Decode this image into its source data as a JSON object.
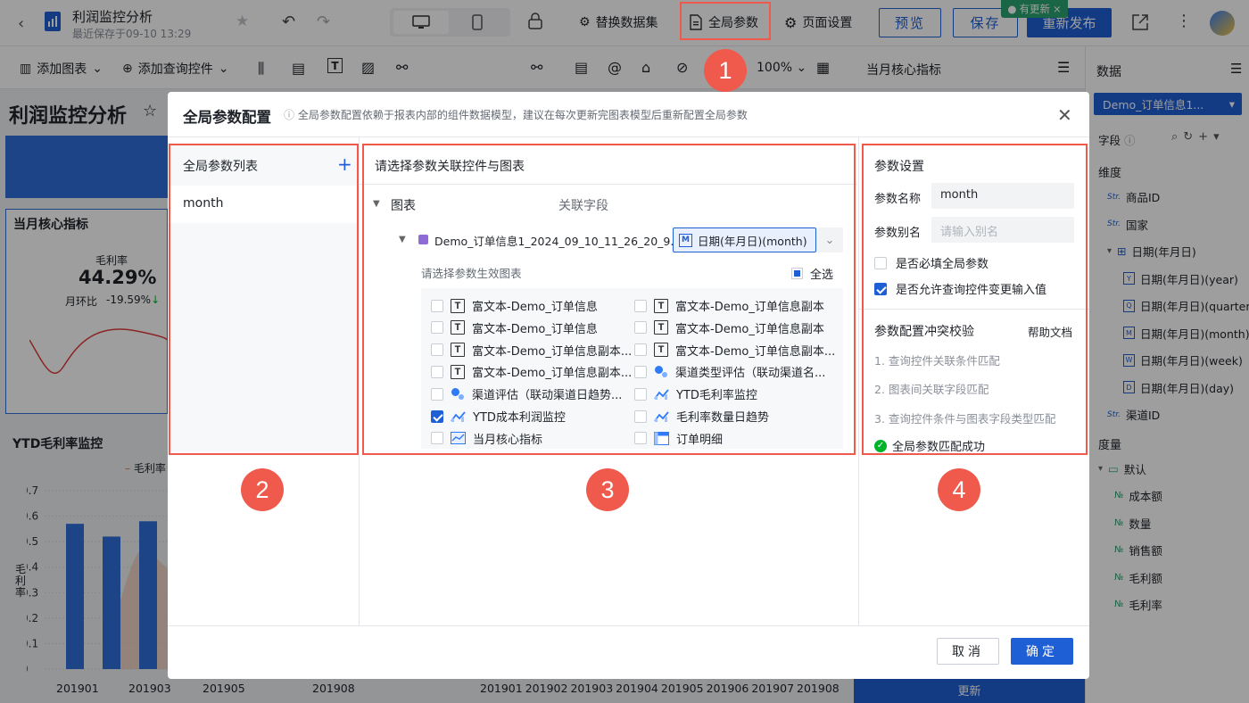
{
  "topbar": {
    "title": "利润监控分析",
    "subtitle": "最近保存于09-10 13:29",
    "switch_dataset": "替换数据集",
    "global_params": "全局参数",
    "page_settings": "页面设置",
    "preview": "预览",
    "save": "保存",
    "republish": "重新发布",
    "update_badge": "有更新"
  },
  "toolbar": {
    "add_chart": "添加图表",
    "add_query": "添加查询控件",
    "zoom": "100%",
    "panel_title": "当月核心指标"
  },
  "dashboard": {
    "title": "利润监控分析",
    "card1_title": "当月核心指标",
    "kpi_label": "毛利率",
    "kpi_value": "44.29%",
    "kpi_mom_label": "月环比",
    "kpi_mom_value": "-19.59%",
    "card2_title": "YTD毛利率监控",
    "legend": "毛利率",
    "ylabel": "毛利率",
    "y_ticks": [
      "0.7",
      "0.6",
      "0.5",
      "0.4",
      "0.3",
      "0.2",
      "0.1",
      "0"
    ],
    "x_ticks": [
      "201901",
      "201903",
      "201905",
      "201908"
    ],
    "x_ticks2": [
      "201901",
      "201902",
      "201903",
      "201904",
      "201905",
      "201906",
      "201907",
      "201908"
    ],
    "update_btn": "更新"
  },
  "chart_data": {
    "type": "bar",
    "categories": [
      "201901",
      "201902",
      "201903"
    ],
    "values": [
      0.57,
      0.52,
      0.58
    ],
    "ylim": [
      0,
      0.7
    ]
  },
  "data_panel": {
    "title": "数据",
    "dataset": "Demo_订单信息1...",
    "fields_label": "字段",
    "dim_label": "维度",
    "dims": [
      "商品ID",
      "国家",
      "日期(年月日)",
      "日期(年月日)(year)",
      "日期(年月日)(quarter)",
      "日期(年月日)(month)",
      "日期(年月日)(week)",
      "日期(年月日)(day)",
      "渠道ID"
    ],
    "measure_label": "度量",
    "folder": "默认",
    "measures": [
      "成本额",
      "数量",
      "销售额",
      "毛利额",
      "毛利率"
    ]
  },
  "modal": {
    "title": "全局参数配置",
    "hint": "全局参数配置依赖于报表内部的组件数据模型，建议在每次更新完图表模型后重新配置全局参数",
    "list_title": "全局参数列表",
    "param_item": "month",
    "mid_title": "请选择参数关联控件与图表",
    "tree_chart": "图表",
    "tree_field_label": "关联字段",
    "dataset_node": "Demo_订单信息1_2024_09_10_11_26_20_9...",
    "field_value": "日期(年月日)(month)",
    "effect_label": "请选择参数生效图表",
    "select_all": "全选",
    "charts_left": [
      {
        "label": "富文本-Demo_订单信息",
        "checked": false,
        "icon": "T"
      },
      {
        "label": "富文本-Demo_订单信息",
        "checked": false,
        "icon": "T"
      },
      {
        "label": "富文本-Demo_订单信息副本...",
        "checked": false,
        "icon": "T"
      },
      {
        "label": "富文本-Demo_订单信息副本...",
        "checked": false,
        "icon": "T"
      },
      {
        "label": "渠道评估（联动渠道日趋势...",
        "checked": false,
        "icon": "dot"
      },
      {
        "label": "YTD成本利润监控",
        "checked": true,
        "icon": "line"
      },
      {
        "label": "当月核心指标",
        "checked": false,
        "icon": "kpi"
      }
    ],
    "charts_right": [
      {
        "label": "富文本-Demo_订单信息副本",
        "checked": false,
        "icon": "T"
      },
      {
        "label": "富文本-Demo_订单信息副本",
        "checked": false,
        "icon": "T"
      },
      {
        "label": "富文本-Demo_订单信息副本...",
        "checked": false,
        "icon": "T"
      },
      {
        "label": "渠道类型评估（联动渠道名...",
        "checked": false,
        "icon": "dot"
      },
      {
        "label": "YTD毛利率监控",
        "checked": false,
        "icon": "line"
      },
      {
        "label": "毛利率数量日趋势",
        "checked": false,
        "icon": "line"
      },
      {
        "label": "订单明细",
        "checked": false,
        "icon": "table"
      }
    ],
    "settings_title": "参数设置",
    "name_label": "参数名称",
    "name_value": "month",
    "alias_label": "参数别名",
    "alias_placeholder": "请输入别名",
    "required_label": "是否必填全局参数",
    "allow_label": "是否允许查询控件变更输入值",
    "conflict_title": "参数配置冲突校验",
    "help_link": "帮助文档",
    "checks": [
      "1. 查询控件关联条件匹配",
      "2. 图表间关联字段匹配",
      "3. 查询控件条件与图表字段类型匹配"
    ],
    "success": "全局参数匹配成功",
    "cancel": "取消",
    "ok": "确定"
  },
  "annotations": [
    "1",
    "2",
    "3",
    "4"
  ],
  "colors": {
    "accent": "#1f5fd6",
    "annotation": "#ef5a4c",
    "success": "#00b42a"
  }
}
